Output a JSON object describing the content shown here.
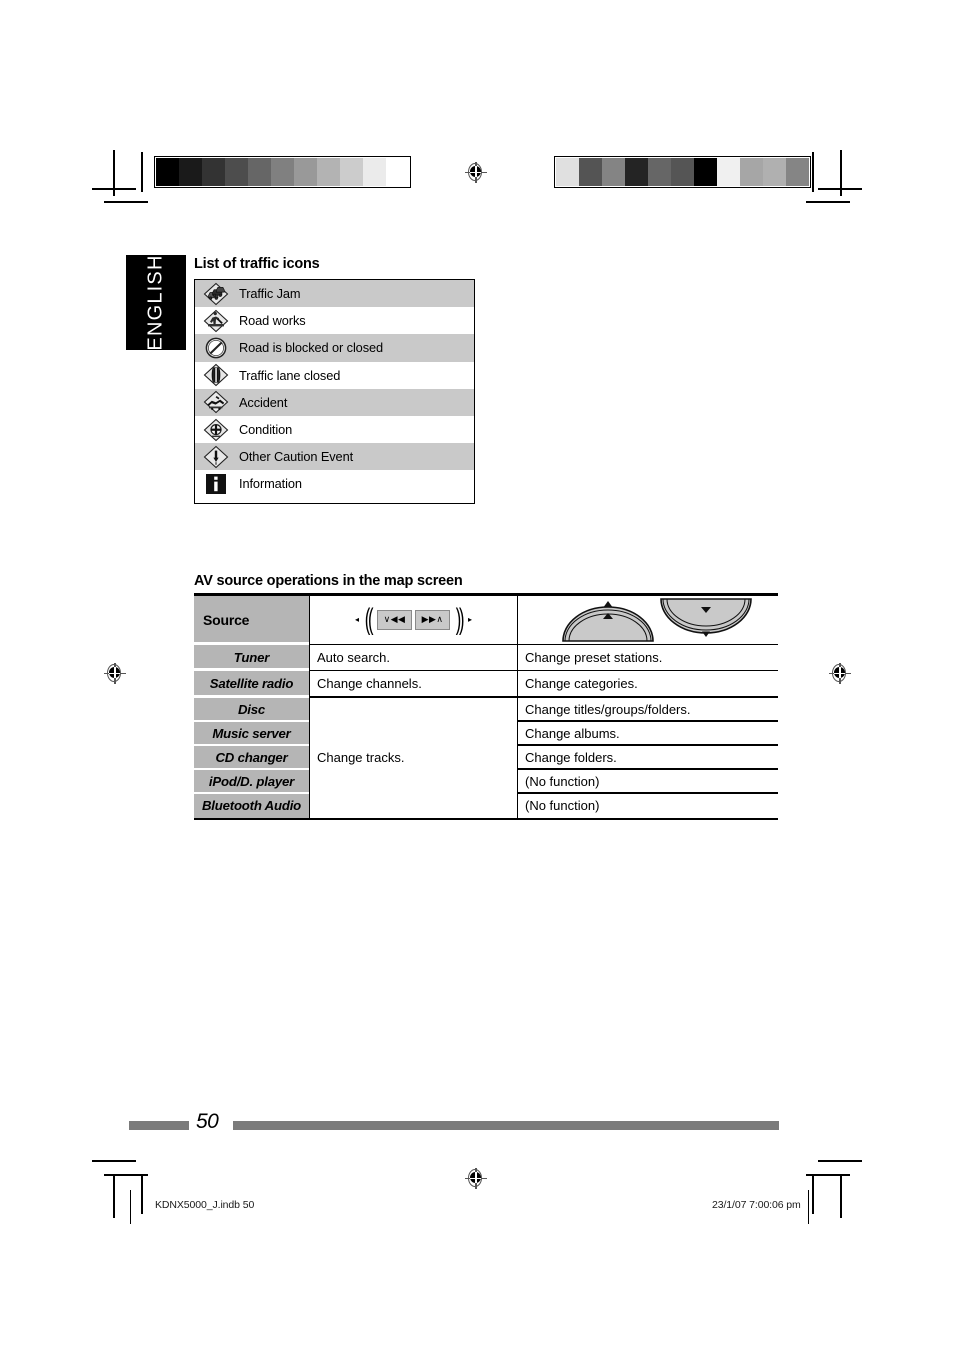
{
  "page": {
    "language_tab": "ENGLISH",
    "page_number": "50"
  },
  "traffic_section": {
    "heading": "List of traffic icons",
    "items": [
      {
        "icon": "traffic-jam-icon",
        "label": "Traffic Jam"
      },
      {
        "icon": "road-works-icon",
        "label": "Road works"
      },
      {
        "icon": "road-blocked-icon",
        "label": "Road is blocked or closed"
      },
      {
        "icon": "traffic-lane-closed-icon",
        "label": "Traffic lane closed"
      },
      {
        "icon": "accident-icon",
        "label": "Accident"
      },
      {
        "icon": "condition-icon",
        "label": "Condition"
      },
      {
        "icon": "other-caution-event-icon",
        "label": "Other Caution Event"
      },
      {
        "icon": "information-icon",
        "label": "Information"
      }
    ]
  },
  "av_section": {
    "heading": "AV source operations in the map screen",
    "columns": {
      "source_header": "Source",
      "track_buttons_header_icon": "track-skip-buttons-icon",
      "arc_buttons_header_icon": "arc-updown-buttons-icon",
      "key_left_label": "∨◀◀",
      "key_right_label": "▶▶∧"
    },
    "rows": [
      {
        "source": "Tuner",
        "track": "Auto search.",
        "arc": "Change preset stations."
      },
      {
        "source": "Satellite radio",
        "track": "Change channels.",
        "arc": "Change categories."
      },
      {
        "source": "Disc",
        "track": "",
        "arc": "Change titles/groups/folders."
      },
      {
        "source": "Music server",
        "track": "",
        "arc": "Change albums."
      },
      {
        "source": "CD changer",
        "track": "Change tracks.",
        "arc": "Change folders."
      },
      {
        "source": "iPod/D. player",
        "track": "",
        "arc": "(No function)"
      },
      {
        "source": "Bluetooth Audio",
        "track": "",
        "arc": "(No function)"
      }
    ],
    "merged_track_label": "Change tracks."
  },
  "print_marks": {
    "grayscale_left": [
      "#000000",
      "#1a1a1a",
      "#333333",
      "#4d4d4d",
      "#666666",
      "#808080",
      "#999999",
      "#b3b3b3",
      "#cccccc",
      "#ebebeb",
      "#ffffff"
    ],
    "grayscale_right": [
      "#e0e0e0",
      "#545454",
      "#848484",
      "#242424",
      "#666666",
      "#555555",
      "#000000",
      "#f0f0f0",
      "#a6a6a6",
      "#b0b0b0",
      "#858585"
    ],
    "slug_left": "KDNX5000_J.indb   50",
    "slug_right": "23/1/07   7:00:06 pm"
  }
}
